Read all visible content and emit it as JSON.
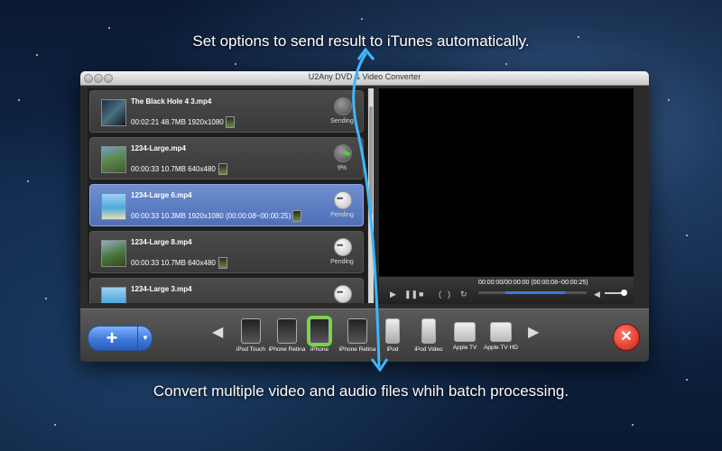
{
  "captions": {
    "top": "Set options to send result to iTunes automatically.",
    "bottom": "Convert multiple video and audio files whih batch processing."
  },
  "window": {
    "title": "U2Any DVD & Video Converter"
  },
  "files": [
    {
      "name": "The Black Hole 4 3.mp4",
      "meta": "00:02:21  48.7MB  1920x1080",
      "status": "Sending",
      "selected": false
    },
    {
      "name": "1234-Large.mp4",
      "meta": "00:00:33  10.7MB  640x480",
      "status": "9%",
      "selected": false
    },
    {
      "name": "1234-Large 6.mp4",
      "meta": "00:00:33  10.3MB  1920x1080  (00:00:08~00:00:25)",
      "status": "Pending",
      "selected": true
    },
    {
      "name": "1234-Large 8.mp4",
      "meta": "00:00:33  10.7MB  640x480",
      "status": "Pending",
      "selected": false
    },
    {
      "name": "1234-Large 3.mp4",
      "meta": "",
      "status": "",
      "selected": false
    }
  ],
  "player": {
    "timecode": "00:00:00/00:00:00   (00:00:08~00:00:25)",
    "play_icon": "play-icon",
    "pause_icon": "pause-icon",
    "stop_icon": "stop-icon"
  },
  "devices": [
    {
      "label": "iPod Touch"
    },
    {
      "label": "iPhone Retina"
    },
    {
      "label": "iPhone"
    },
    {
      "label": "iPhone Retina"
    },
    {
      "label": "iPod"
    },
    {
      "label": "iPod Video"
    },
    {
      "label": "Apple TV"
    },
    {
      "label": "Apple TV HD"
    }
  ],
  "selected_device": "iPhone",
  "colors": {
    "accent_blue": "#3f78d8",
    "selection_green": "#6fdc3a",
    "close_red": "#d01e14"
  }
}
